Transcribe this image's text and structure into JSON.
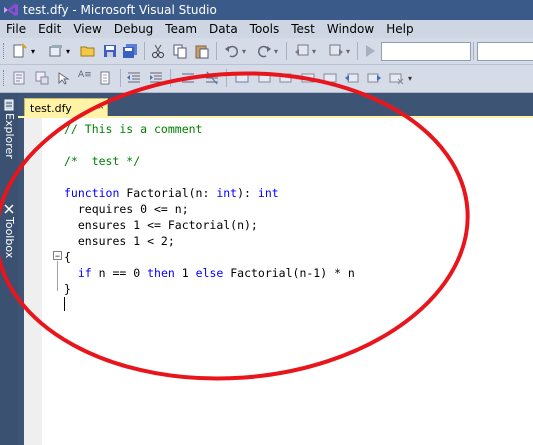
{
  "window": {
    "title": "test.dfy - Microsoft Visual Studio"
  },
  "menu": [
    "File",
    "Edit",
    "View",
    "Debug",
    "Team",
    "Data",
    "Tools",
    "Test",
    "Window",
    "Help"
  ],
  "dock": {
    "server_explorer": "Server Explorer",
    "toolbox": "Toolbox"
  },
  "document_tab": {
    "label": "test.dfy",
    "close": "×"
  },
  "editor": {
    "lines": [
      {
        "parts": [
          {
            "t": "// This is a comment",
            "c": "cm"
          }
        ]
      },
      {
        "parts": []
      },
      {
        "parts": [
          {
            "t": "/*  test */",
            "c": "cm"
          }
        ]
      },
      {
        "parts": []
      },
      {
        "parts": [
          {
            "t": "function",
            "c": "kw"
          },
          {
            "t": " Factorial(n: ",
            "c": ""
          },
          {
            "t": "int",
            "c": "kw"
          },
          {
            "t": "): ",
            "c": ""
          },
          {
            "t": "int",
            "c": "kw"
          }
        ]
      },
      {
        "parts": [
          {
            "t": "  requires 0 <= n;",
            "c": ""
          }
        ]
      },
      {
        "parts": [
          {
            "t": "  ensures 1 <= Factorial(n);",
            "c": ""
          }
        ]
      },
      {
        "parts": [
          {
            "t": "  ensures 1 < 2;",
            "c": ""
          }
        ]
      },
      {
        "parts": [
          {
            "t": "{",
            "c": ""
          }
        ]
      },
      {
        "parts": [
          {
            "t": "  ",
            "c": ""
          },
          {
            "t": "if",
            "c": "kw"
          },
          {
            "t": " n == 0 ",
            "c": ""
          },
          {
            "t": "then",
            "c": "kw"
          },
          {
            "t": " 1 ",
            "c": ""
          },
          {
            "t": "else",
            "c": "kw"
          },
          {
            "t": " Factorial(n-1) * n",
            "c": ""
          }
        ]
      },
      {
        "parts": [
          {
            "t": "}",
            "c": ""
          }
        ]
      }
    ]
  },
  "colors": {
    "annotation_circle": "#e8151c",
    "keyword": "#0000ff",
    "comment": "#008000"
  }
}
